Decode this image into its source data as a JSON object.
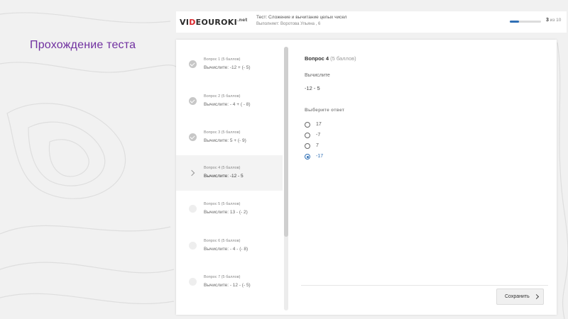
{
  "slide": {
    "title": "Прохождение теста"
  },
  "header": {
    "logo_prefix": "VI",
    "logo_accent": "D",
    "logo_rest": "EOUROKI",
    "logo_sup": ".net",
    "test_title": "Тест: Сложение и вычитание целых чисел",
    "test_author": "Выполняет: Воротова Ульяна , 6",
    "progress": {
      "current": "3",
      "total_text": "из 10",
      "fraction": 0.3
    }
  },
  "questions": [
    {
      "label": "Вопрос 1 (5 баллов)",
      "text": "Вычислите: -12 + (- 5)",
      "status": "done"
    },
    {
      "label": "Вопрос 2 (5 баллов)",
      "text": "Вычислите: - 4 + ( - 8)",
      "status": "done"
    },
    {
      "label": "Вопрос 3 (5 баллов)",
      "text": "Вычислите: 5 + (- 9)",
      "status": "done"
    },
    {
      "label": "Вопрос 4 (5 баллов)",
      "text": "Вычислите: -12 - 5",
      "status": "current"
    },
    {
      "label": "Вопрос 5 (5 баллов)",
      "text": "Вычислите: 13 - (- 2)",
      "status": "pending"
    },
    {
      "label": "Вопрос 6 (5 баллов)",
      "text": "Вычислите: - 4 - (- 8)",
      "status": "pending"
    },
    {
      "label": "Вопрос 7 (5 баллов)",
      "text": "Вычислите: - 12 - (- 5)",
      "status": "pending"
    }
  ],
  "current_question": {
    "title": "Вопрос 4",
    "points": "(5 баллов)",
    "prompt": "Вычислите",
    "expression": "-12 - 5",
    "choose_label": "Выберите ответ",
    "options": [
      {
        "label": "17",
        "selected": false
      },
      {
        "label": "-7",
        "selected": false
      },
      {
        "label": "7",
        "selected": false
      },
      {
        "label": "-17",
        "selected": true
      }
    ]
  },
  "footer": {
    "save_label": "Сохранить"
  },
  "colors": {
    "accent": "#2f6fb5",
    "logo_red": "#d9262b",
    "slide_title": "#7030a0"
  }
}
